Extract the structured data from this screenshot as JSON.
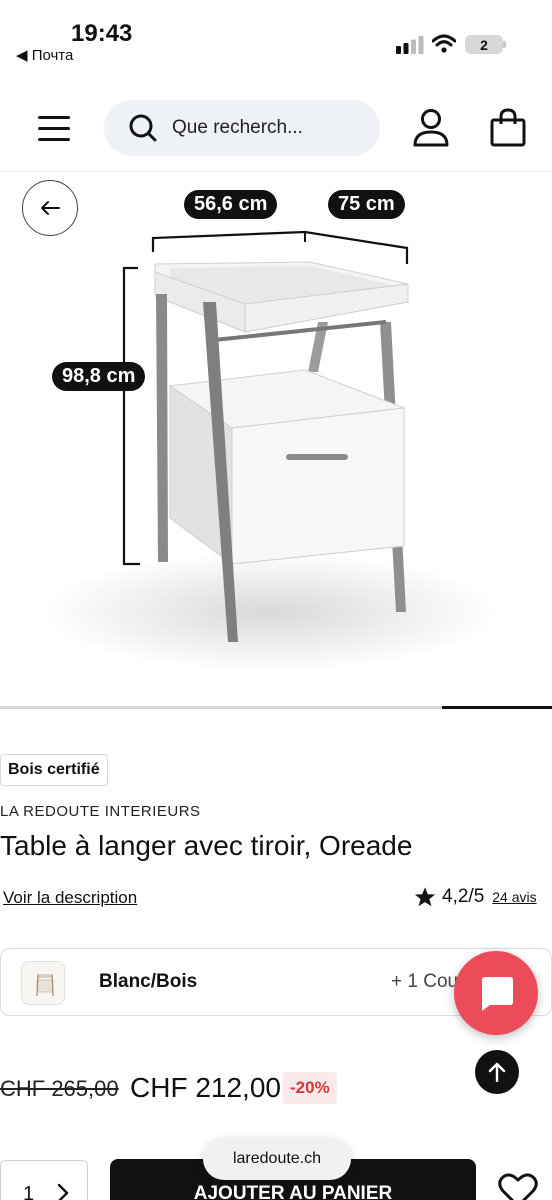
{
  "status_bar": {
    "time": "19:43",
    "back_app": "◀ Почта",
    "battery": "2"
  },
  "header": {
    "search_placeholder": "Que recherch..."
  },
  "gallery": {
    "dimensions": {
      "width": "56,6 cm",
      "depth": "75 cm",
      "height": "98,8 cm"
    },
    "image_progress": 0.2
  },
  "product": {
    "badge": "Bois certifié",
    "brand": "LA REDOUTE INTERIEURS",
    "title": "Table à langer avec tiroir, Oreade",
    "description_link": "Voir la description",
    "rating": "4,2/5",
    "reviews": "24 avis",
    "variant": {
      "name": "Blanc/Bois",
      "more": "+ 1 Cou"
    },
    "old_price": "CHF 265,00",
    "new_price": "CHF 212,00",
    "discount": "-20%"
  },
  "cart": {
    "quantity": "1",
    "add_to_cart": "AJOUTER AU PANIER"
  },
  "browser": {
    "url": "laredoute.ch"
  },
  "colors": {
    "accent_chat": "#ec4c5a",
    "discount_text": "#d23a3a",
    "discount_bg": "#fbeaea"
  },
  "icons": [
    "search-icon",
    "user-icon",
    "bag-icon",
    "menu-icon",
    "arrow-left-icon",
    "star-icon",
    "chat-icon",
    "arrow-up-icon",
    "chevron-right-icon",
    "heart-icon"
  ]
}
